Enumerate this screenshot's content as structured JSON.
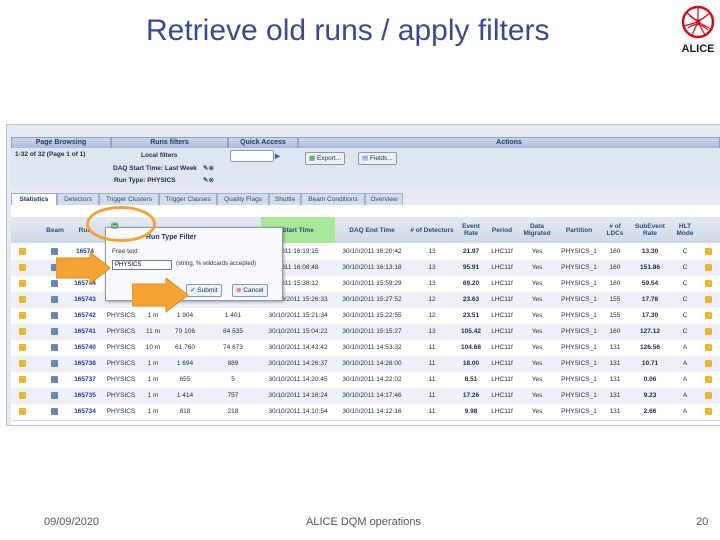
{
  "slide": {
    "title": "Retrieve old runs / apply filters",
    "footer_date": "09/09/2020",
    "footer_center": "ALICE DQM operations",
    "page_number": "20",
    "logo_text": "ALICE"
  },
  "toolbar": {
    "page_browsing_title": "Page Browsing",
    "page_info": "1-32 of 32 (Page 1 of 1)",
    "runs_filters_title": "Runs filters",
    "local_filters_label": "Local filters",
    "daq_start_label": "DAQ Start Time: Last Week",
    "run_type_label": "Run Type: PHYSICS",
    "quick_access_title": "Quick Access",
    "actions_title": "Actions",
    "export_label": "Export...",
    "fields_label": "Fields..."
  },
  "tabs": [
    "Statistics",
    "Detectors",
    "Trigger Clusters",
    "Trigger Classes",
    "Quality Flags",
    "Shuttle",
    "Beam Conditions",
    "Overview"
  ],
  "columns": {
    "beam": "Beam",
    "run": "Run",
    "start_time": "Start Time",
    "daq_end": "DAQ End Time",
    "detectors": "# of Detectors",
    "event_rate": "Event Rate",
    "period": "Period",
    "data_migrated": "Data Migrated",
    "partition": "Partition",
    "ldcs": "# of LDCs",
    "subevent_rate": "SubEvent Rate",
    "hlt_mode": "HLT Mode"
  },
  "popup": {
    "title": "Run Type Filter",
    "free_text_label": "Free text",
    "input_value": "PHYSICS",
    "hint": "(string, % wildcards accepted)",
    "submit_label": "Submit",
    "cancel_label": "Cancel"
  },
  "rows": [
    {
      "run": "165744",
      "type": "PHYSICS",
      "dur": "",
      "n1": "",
      "n2": "",
      "start": "2011 15:38:12",
      "end": "30/10/2011 15:59:29",
      "det": "13",
      "ev": "69.20",
      "period": "LHC11f",
      "mig": "Yes",
      "part": "PHYSICS_1",
      "ldc": "160",
      "sub": "59.54",
      "hlt": "C"
    },
    {
      "run": "165743",
      "type": "PHYSICS",
      "dur": "1 m",
      "n1": "1 867",
      "n2": "1 405",
      "start": "30/10/2011 15:26:33",
      "end": "30/10/2011 15:27:52",
      "det": "12",
      "ev": "23.63",
      "period": "LHC11f",
      "mig": "Yes",
      "part": "PHYSICS_1",
      "ldc": "155",
      "sub": "17.78",
      "hlt": "C"
    },
    {
      "run": "165742",
      "type": "PHYSICS",
      "dur": "1 m",
      "n1": "1 904",
      "n2": "1 401",
      "start": "30/10/2011 15:21:34",
      "end": "30/10/2011 15:22:55",
      "det": "12",
      "ev": "23.51",
      "period": "LHC11f",
      "mig": "Yes",
      "part": "PHYSICS_1",
      "ldc": "155",
      "sub": "17.30",
      "hlt": "C"
    },
    {
      "run": "165741",
      "type": "PHYSICS",
      "dur": "11 m",
      "n1": "70 106",
      "n2": "84 535",
      "start": "30/10/2011 15:04:22",
      "end": "30/10/2011 15:15:27",
      "det": "13",
      "ev": "105.42",
      "period": "LHC11f",
      "mig": "Yes",
      "part": "PHYSICS_1",
      "ldc": "160",
      "sub": "127.12",
      "hlt": "C"
    },
    {
      "run": "165740",
      "type": "PHYSICS",
      "dur": "10 m",
      "n1": "61 760",
      "n2": "74 673",
      "start": "30/10/2011 14:43:42",
      "end": "30/10/2011 14:53:32",
      "det": "11",
      "ev": "104.68",
      "period": "LHC11f",
      "mig": "Yes",
      "part": "PHYSICS_1",
      "ldc": "131",
      "sub": "126.56",
      "hlt": "A"
    },
    {
      "run": "165738",
      "type": "PHYSICS",
      "dur": "1 m",
      "n1": "1 694",
      "n2": "889",
      "start": "30/10/2011 14:26:37",
      "end": "30/10/2011 14:28:00",
      "det": "11",
      "ev": "18.00",
      "period": "LHC11f",
      "mig": "Yes",
      "part": "PHYSICS_1",
      "ldc": "131",
      "sub": "10.71",
      "hlt": "A"
    },
    {
      "run": "165737",
      "type": "PHYSICS",
      "dur": "1 m",
      "n1": "655",
      "n2": "5",
      "start": "30/10/2011 14:20:45",
      "end": "30/10/2011 14:22:02",
      "det": "11",
      "ev": "8.51",
      "period": "LHC11f",
      "mig": "Yes",
      "part": "PHYSICS_1",
      "ldc": "131",
      "sub": "0.06",
      "hlt": "A"
    },
    {
      "run": "165735",
      "type": "PHYSICS",
      "dur": "1 m",
      "n1": "1 414",
      "n2": "757",
      "start": "30/10/2011 14:16:24",
      "end": "30/10/2011 14:17:46",
      "det": "11",
      "ev": "17.26",
      "period": "LHC11f",
      "mig": "Yes",
      "part": "PHYSICS_1",
      "ldc": "131",
      "sub": "9.23",
      "hlt": "A"
    },
    {
      "run": "165734",
      "type": "PHYSICS",
      "dur": "1 m",
      "n1": "818",
      "n2": "218",
      "start": "30/10/2011 14:10:54",
      "end": "30/10/2011 14:12:16",
      "det": "11",
      "ev": "9.98",
      "period": "LHC11f",
      "mig": "Yes",
      "part": "PHYSICS_1",
      "ldc": "131",
      "sub": "2.66",
      "hlt": "A"
    }
  ],
  "top_rows": [
    {
      "run": "16574",
      "start": "2011 16:19:15",
      "end": "30/10/2011 16:20:42",
      "det": "13",
      "ev": "21.97",
      "period": "LHC11f",
      "mig": "Yes",
      "part": "PHYSICS_1",
      "ldc": "160",
      "sub": "13.30",
      "hlt": "C"
    },
    {
      "run": "16574",
      "start": "2011 16:08:48",
      "end": "30/10/2011 16:13:18",
      "det": "13",
      "ev": "95.91",
      "period": "LHC11f",
      "mig": "Yes",
      "part": "PHYSICS_1",
      "ldc": "160",
      "sub": "151.86",
      "hlt": "C"
    }
  ]
}
